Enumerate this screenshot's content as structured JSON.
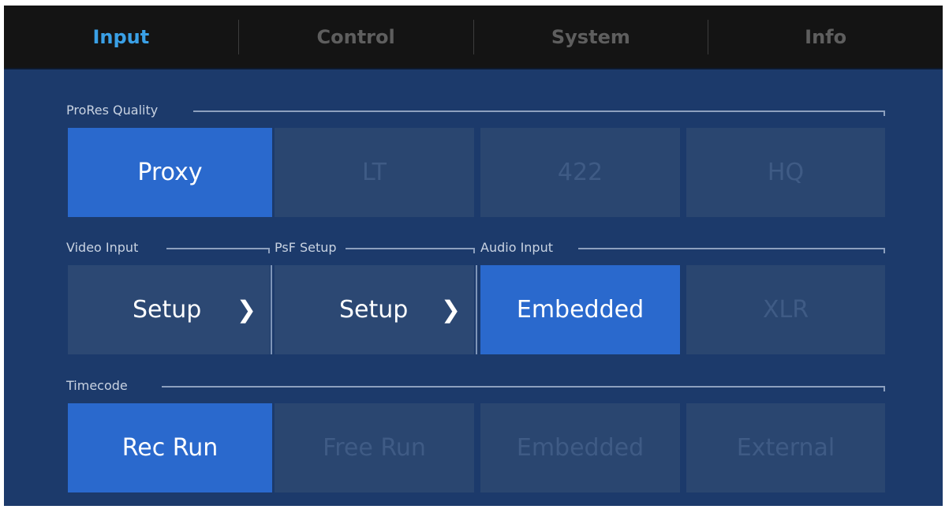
{
  "tabs": [
    {
      "label": "Input",
      "active": true
    },
    {
      "label": "Control",
      "active": false
    },
    {
      "label": "System",
      "active": false
    },
    {
      "label": "Info",
      "active": false
    }
  ],
  "prores": {
    "label": "ProRes Quality",
    "options": [
      "Proxy",
      "LT",
      "422",
      "HQ"
    ],
    "selected": "Proxy"
  },
  "video_input": {
    "label": "Video Input",
    "button": "Setup"
  },
  "psf_setup": {
    "label": "PsF Setup",
    "button": "Setup"
  },
  "audio_input": {
    "label": "Audio Input",
    "options": [
      "Embedded",
      "XLR"
    ],
    "selected": "Embedded"
  },
  "timecode": {
    "label": "Timecode",
    "options": [
      "Rec Run",
      "Free Run",
      "Embedded",
      "External"
    ],
    "selected": "Rec Run"
  },
  "icons": {
    "chevron": "chevron-right-icon"
  },
  "colors": {
    "accent": "#2a69cd",
    "tab_active": "#3aa0e6",
    "background": "#1c3a6b",
    "button": "#2a4670"
  }
}
